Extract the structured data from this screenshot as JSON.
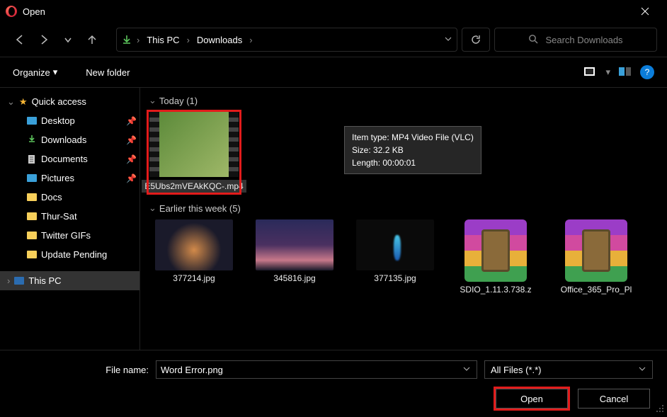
{
  "window": {
    "title": "Open"
  },
  "breadcrumbs": {
    "a": "This PC",
    "b": "Downloads"
  },
  "search": {
    "placeholder": "Search Downloads"
  },
  "toolbar": {
    "organize": "Organize",
    "new_folder": "New folder"
  },
  "sidebar": {
    "quick_access": "Quick access",
    "desktop": "Desktop",
    "downloads": "Downloads",
    "documents": "Documents",
    "pictures": "Pictures",
    "docs": "Docs",
    "thur_sat": "Thur-Sat",
    "twitter": "Twitter GIFs",
    "update": "Update Pending",
    "this_pc": "This PC"
  },
  "groups": {
    "today": "Today (1)",
    "earlier": "Earlier this week (5)"
  },
  "files_today": [
    {
      "name": "E5Ubs2mVEAkKQC-.mp4"
    }
  ],
  "files_earlier": [
    {
      "name": "377214.jpg"
    },
    {
      "name": "345816.jpg"
    },
    {
      "name": "377135.jpg"
    },
    {
      "name": "SDIO_1.11.3.738.z"
    },
    {
      "name": "Office_365_Pro_Pl"
    }
  ],
  "tooltip": {
    "l1": "Item type: MP4 Video File (VLC)",
    "l2": "Size: 32.2 KB",
    "l3": "Length: 00:00:01"
  },
  "footer": {
    "filename_label": "File name:",
    "filename_value": "Word Error.png",
    "filter_value": "All Files (*.*)",
    "open": "Open",
    "cancel": "Cancel"
  }
}
